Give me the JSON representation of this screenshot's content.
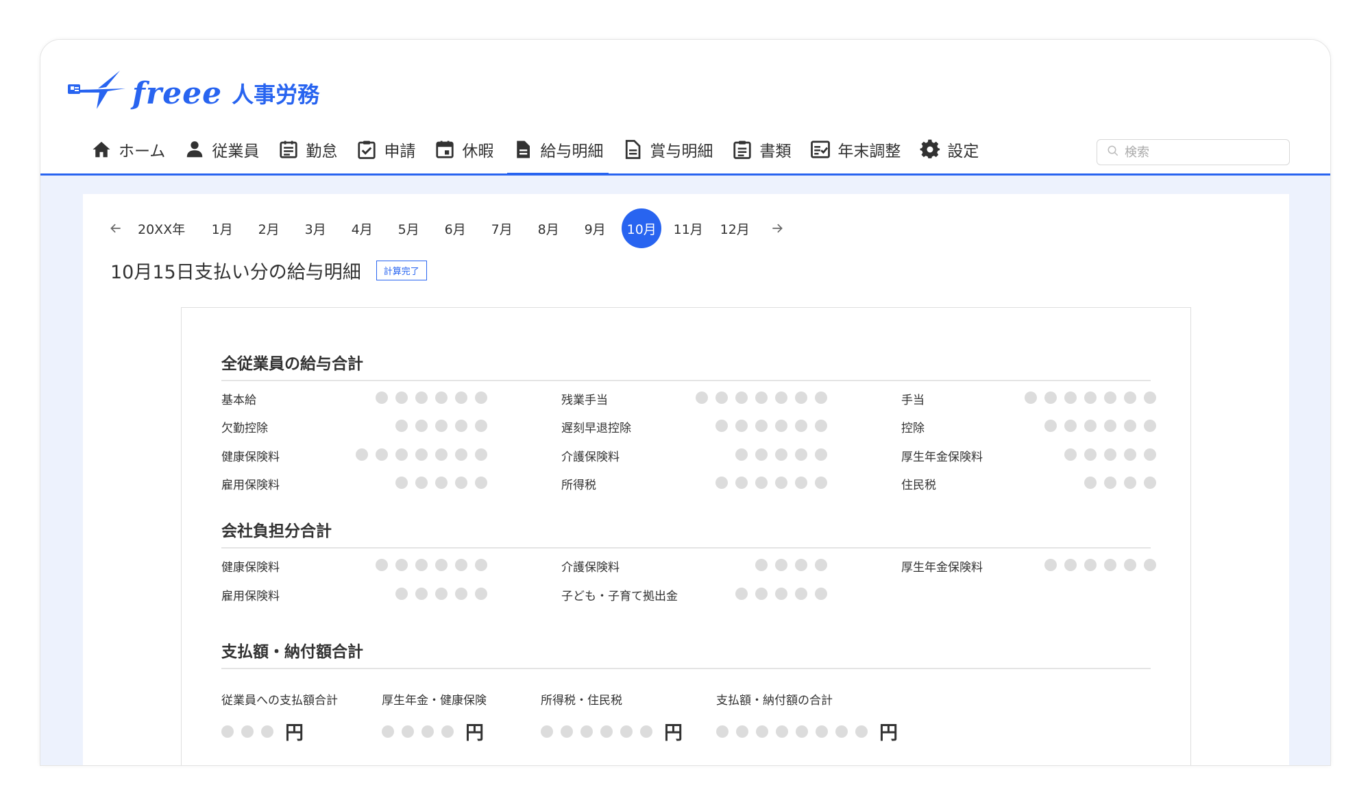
{
  "app": {
    "logo_text": "freee",
    "logo_sub": "人事労務"
  },
  "nav": {
    "items": [
      {
        "label": "ホーム",
        "icon": "home-icon"
      },
      {
        "label": "従業員",
        "icon": "person-icon"
      },
      {
        "label": "勤怠",
        "icon": "timecard-icon"
      },
      {
        "label": "申請",
        "icon": "clipboard-check-icon"
      },
      {
        "label": "休暇",
        "icon": "calendar-icon"
      },
      {
        "label": "給与明細",
        "icon": "document-icon",
        "active": true
      },
      {
        "label": "賞与明細",
        "icon": "document-outline-icon"
      },
      {
        "label": "書類",
        "icon": "clipboard-icon"
      },
      {
        "label": "年末調整",
        "icon": "checklist-icon"
      },
      {
        "label": "設定",
        "icon": "gear-icon"
      }
    ],
    "search_placeholder": "検索"
  },
  "months": {
    "year": "20XX年",
    "items": [
      "1月",
      "2月",
      "3月",
      "4月",
      "5月",
      "6月",
      "7月",
      "8月",
      "9月",
      "10月",
      "11月",
      "12月"
    ],
    "selected": "10月"
  },
  "page": {
    "title": "10月15日支払い分の給与明細",
    "status_badge": "計算完了"
  },
  "sections": {
    "employee_total": {
      "title": "全従業員の給与合計",
      "items": [
        {
          "label": "基本給",
          "masked_digits": 6
        },
        {
          "label": "残業手当",
          "masked_digits": 7
        },
        {
          "label": "手当",
          "masked_digits": 7
        },
        {
          "label": "欠勤控除",
          "masked_digits": 5
        },
        {
          "label": "遅刻早退控除",
          "masked_digits": 6
        },
        {
          "label": "控除",
          "masked_digits": 6
        },
        {
          "label": "健康保険料",
          "masked_digits": 7
        },
        {
          "label": "介護保険料",
          "masked_digits": 5
        },
        {
          "label": "厚生年金保険料",
          "masked_digits": 5
        },
        {
          "label": "雇用保険料",
          "masked_digits": 5
        },
        {
          "label": "所得税",
          "masked_digits": 6
        },
        {
          "label": "住民税",
          "masked_digits": 4
        }
      ]
    },
    "company_total": {
      "title": "会社負担分合計",
      "items": [
        {
          "label": "健康保険料",
          "masked_digits": 6
        },
        {
          "label": "介護保険料",
          "masked_digits": 4
        },
        {
          "label": "厚生年金保険料",
          "masked_digits": 6
        },
        {
          "label": "雇用保険料",
          "masked_digits": 5
        },
        {
          "label": "子ども・子育て拠出金",
          "masked_digits": 5
        }
      ]
    },
    "payment_total": {
      "title": "支払額・納付額合計",
      "items": [
        {
          "label": "従業員への支払額合計",
          "masked_digits": 3,
          "unit": "円"
        },
        {
          "label": "厚生年金・健康保険",
          "masked_digits": 4,
          "unit": "円"
        },
        {
          "label": "所得税・住民税",
          "masked_digits": 6,
          "unit": "円"
        },
        {
          "label": "支払額・納付額の合計",
          "masked_digits": 8,
          "unit": "円"
        }
      ]
    }
  },
  "colors": {
    "accent": "#2864f0",
    "background": "#edf2fd",
    "masked_dot": "#dcdcdc"
  }
}
